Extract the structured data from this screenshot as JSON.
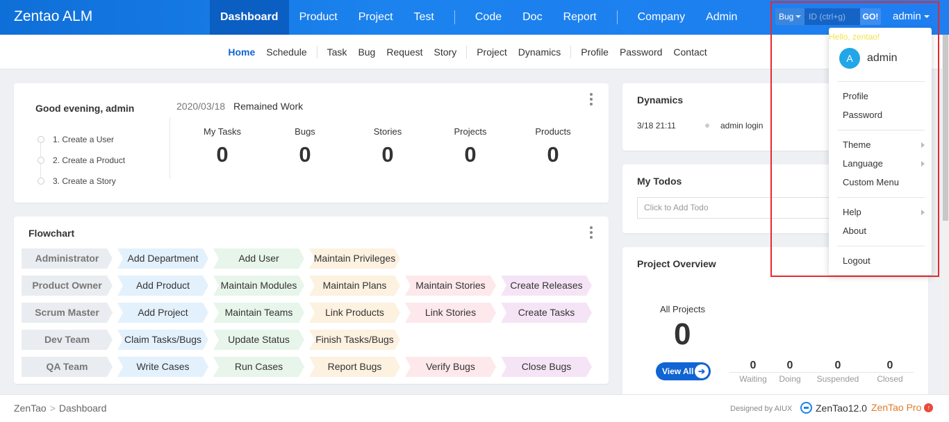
{
  "app": {
    "title": "Zentao ALM"
  },
  "main_nav": {
    "group1": [
      {
        "label": "Dashboard",
        "active": true
      },
      {
        "label": "Product"
      },
      {
        "label": "Project"
      },
      {
        "label": "Test"
      }
    ],
    "group2": [
      {
        "label": "Code"
      },
      {
        "label": "Doc"
      },
      {
        "label": "Report"
      }
    ],
    "group3": [
      {
        "label": "Company"
      },
      {
        "label": "Admin"
      }
    ]
  },
  "search": {
    "type_label": "Bug",
    "placeholder": "ID (ctrl+g)",
    "go_label": "GO!"
  },
  "user": {
    "name": "admin"
  },
  "sub_nav": {
    "group1": [
      {
        "label": "Home",
        "active": true
      },
      {
        "label": "Schedule"
      }
    ],
    "group2": [
      {
        "label": "Task"
      },
      {
        "label": "Bug"
      },
      {
        "label": "Request"
      },
      {
        "label": "Story"
      }
    ],
    "group3": [
      {
        "label": "Project"
      },
      {
        "label": "Dynamics"
      }
    ],
    "group4": [
      {
        "label": "Profile"
      },
      {
        "label": "Password"
      },
      {
        "label": "Contact"
      }
    ]
  },
  "welcome": {
    "greeting": "Good evening, admin",
    "steps": [
      "1. Create a User",
      "2. Create a Product",
      "3. Create a Story"
    ],
    "date": "2020/03/18",
    "remained_label": "Remained Work",
    "stats": [
      {
        "label": "My Tasks",
        "value": "0"
      },
      {
        "label": "Bugs",
        "value": "0"
      },
      {
        "label": "Stories",
        "value": "0"
      },
      {
        "label": "Projects",
        "value": "0"
      },
      {
        "label": "Products",
        "value": "0"
      }
    ]
  },
  "flowchart": {
    "title": "Flowchart",
    "rows": [
      {
        "role": "Administrator",
        "steps": [
          "Add Department",
          "Add User",
          "Maintain Privileges"
        ]
      },
      {
        "role": "Product Owner",
        "steps": [
          "Add Product",
          "Maintain Modules",
          "Maintain Plans",
          "Maintain Stories",
          "Create Releases"
        ]
      },
      {
        "role": "Scrum Master",
        "steps": [
          "Add Project",
          "Maintain Teams",
          "Link Products",
          "Link Stories",
          "Create Tasks"
        ]
      },
      {
        "role": "Dev Team",
        "steps": [
          "Claim Tasks/Bugs",
          "Update Status",
          "Finish Tasks/Bugs"
        ]
      },
      {
        "role": "QA Team",
        "steps": [
          "Write Cases",
          "Run Cases",
          "Report Bugs",
          "Verify Bugs",
          "Close Bugs"
        ]
      }
    ]
  },
  "dynamics": {
    "title": "Dynamics",
    "entries": [
      {
        "time": "3/18 21:11",
        "text": "admin login"
      }
    ]
  },
  "todos": {
    "title": "My Todos",
    "placeholder": "Click to Add Todo"
  },
  "project_overview": {
    "title": "Project Overview",
    "all_label": "All Projects",
    "all_value": "0",
    "view_all": "View All",
    "stats": [
      {
        "label": "Waiting",
        "value": "0"
      },
      {
        "label": "Doing",
        "value": "0"
      },
      {
        "label": "Suspended",
        "value": "0"
      },
      {
        "label": "Closed",
        "value": "0"
      }
    ]
  },
  "footer": {
    "breadcrumb": [
      "ZenTao",
      "Dashboard"
    ],
    "designed_by": "Designed by AIUX",
    "version": "ZenTao12.0",
    "pro": "ZenTao Pro"
  },
  "user_dropdown": {
    "hello": "Hello, zentao!",
    "avatar_letter": "A",
    "username": "admin",
    "groups": [
      [
        {
          "label": "Profile"
        },
        {
          "label": "Password"
        }
      ],
      [
        {
          "label": "Theme",
          "submenu": true
        },
        {
          "label": "Language",
          "submenu": true
        },
        {
          "label": "Custom Menu"
        }
      ],
      [
        {
          "label": "Help",
          "submenu": true
        },
        {
          "label": "About"
        }
      ],
      [
        {
          "label": "Logout"
        }
      ]
    ]
  },
  "colors": {
    "accent": "#1064d3",
    "highlight": "#e8282b"
  }
}
